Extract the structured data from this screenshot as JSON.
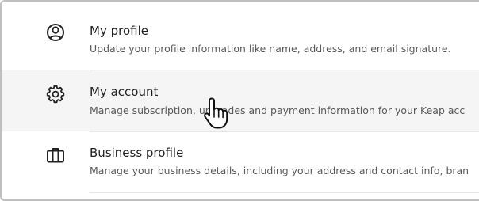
{
  "menu": {
    "items": [
      {
        "title": "My profile",
        "description": "Update your profile information like name, address, and email signature.",
        "icon": "user-circle-icon"
      },
      {
        "title": "My account",
        "description": "Manage subscription, upgrades and payment information for your Keap acc",
        "icon": "gear-icon"
      },
      {
        "title": "Business profile",
        "description": "Manage your business details, including your address and contact info, bran",
        "icon": "briefcase-icon"
      }
    ]
  },
  "colors": {
    "hover_background": "#f5f5f5",
    "title": "#1f1f1f",
    "description": "#595959"
  },
  "cursor_icon": "hand-pointer-icon"
}
